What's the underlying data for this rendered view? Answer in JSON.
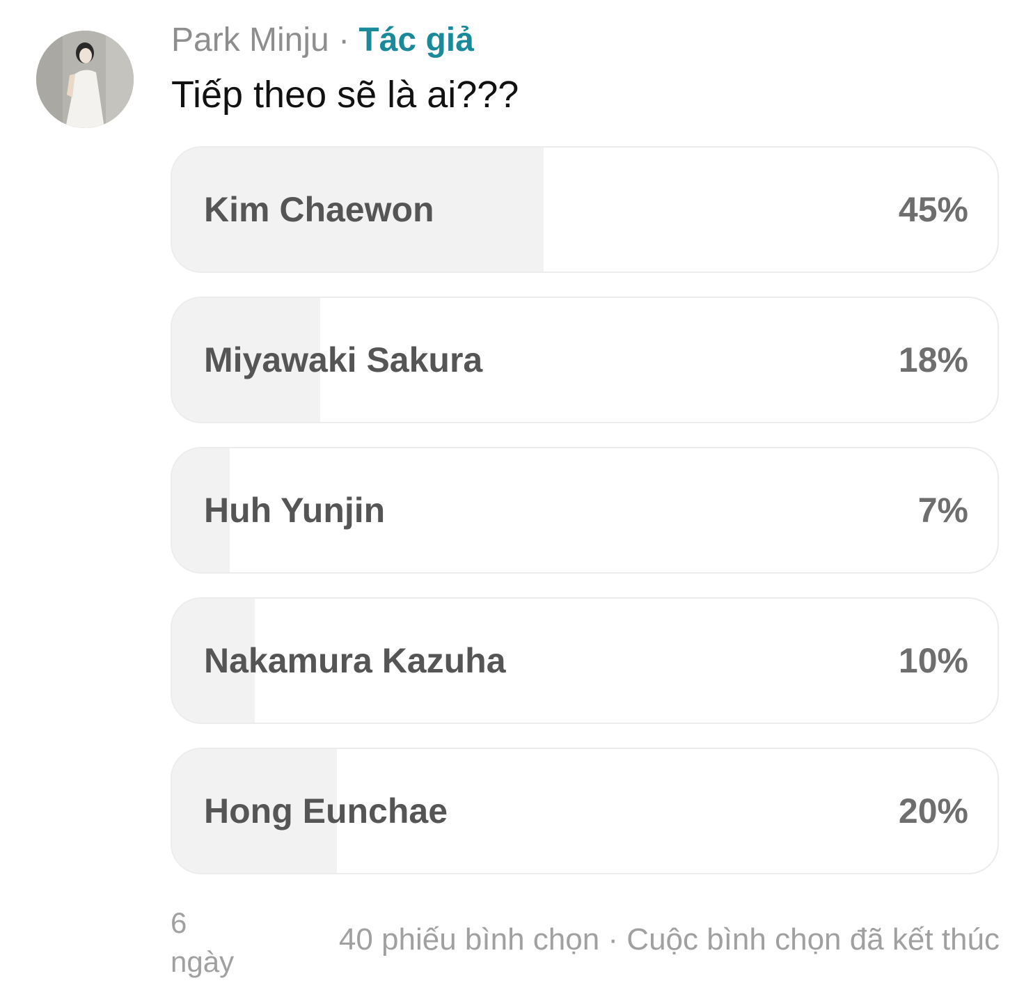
{
  "post": {
    "author": "Park Minju",
    "separator": "·",
    "author_badge": "Tác giả",
    "text": "Tiếp theo sẽ là ai???"
  },
  "poll": {
    "options": [
      {
        "label": "Kim Chaewon",
        "percent": "45%",
        "value": 0.45
      },
      {
        "label": "Miyawaki Sakura",
        "percent": "18%",
        "value": 0.18
      },
      {
        "label": "Huh Yunjin",
        "percent": "7%",
        "value": 0.07
      },
      {
        "label": "Nakamura Kazuha",
        "percent": "10%",
        "value": 0.1
      },
      {
        "label": "Hong Eunchae",
        "percent": "20%",
        "value": 0.2
      }
    ],
    "time_ago": "6 ngày",
    "summary": "40 phiếu bình chọn · Cuộc bình chọn đã kết thúc"
  },
  "colors": {
    "author_badge": "#1a8a9a",
    "fill": "#f2f2f2",
    "muted": "#a0a0a0"
  }
}
